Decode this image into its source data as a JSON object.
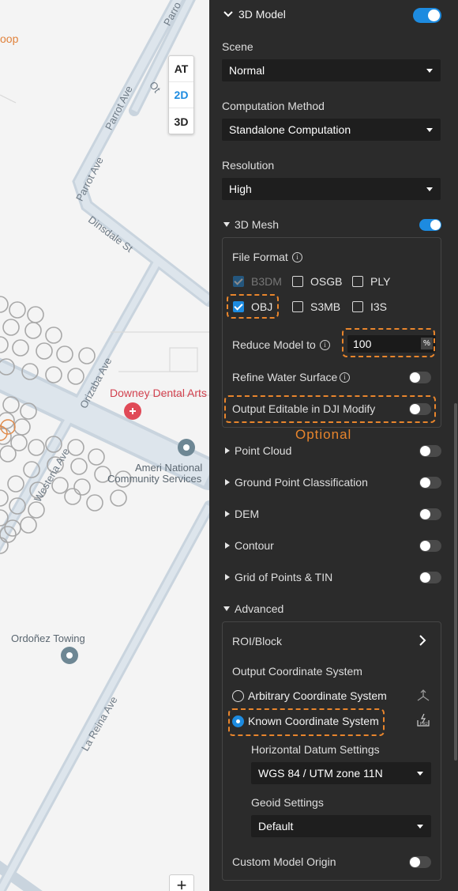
{
  "map": {
    "view_modes": [
      "AT",
      "2D",
      "3D"
    ],
    "active_view": "2D",
    "zoom_in": "+",
    "labels": {
      "loop": "oop",
      "parrot_ave_1": "Parrot Ave",
      "parrot_ave_2": "Parrot Ave",
      "parrot_ave_3": "Parrot Ave",
      "dinsdale": "Dinsdale St",
      "orizaba": "Orizaba Ave",
      "westeria": "Westeria Ave",
      "la_reina": "La Reina Ave",
      "top_street": "Parro",
      "ot_street": "Ot",
      "downey_dental": "Downey Dental Arts",
      "ameri_national": "Ameri National",
      "community_services": "Community Services",
      "ordonez": "Ordoñez Towing"
    }
  },
  "panel": {
    "section_title": "3D Model",
    "section_enabled": true,
    "scene_label": "Scene",
    "scene_value": "Normal",
    "computation_label": "Computation Method",
    "computation_value": "Standalone Computation",
    "resolution_label": "Resolution",
    "resolution_value": "High",
    "mesh": {
      "title": "3D Mesh",
      "enabled": true,
      "file_format_label": "File Format",
      "formats": [
        {
          "name": "B3DM",
          "checked": true,
          "disabled": true
        },
        {
          "name": "OSGB",
          "checked": false,
          "disabled": false
        },
        {
          "name": "PLY",
          "checked": false,
          "disabled": false
        },
        {
          "name": "OBJ",
          "checked": true,
          "disabled": false
        },
        {
          "name": "S3MB",
          "checked": false,
          "disabled": false
        },
        {
          "name": "I3S",
          "checked": false,
          "disabled": false
        }
      ],
      "reduce_label": "Reduce Model to",
      "reduce_value": "100",
      "reduce_unit": "%",
      "refine_water_label": "Refine Water Surface",
      "refine_water_enabled": false,
      "output_editable_label": "Output Editable in DJI Modify",
      "output_editable_enabled": false,
      "optional_note": "Optional"
    },
    "sections": [
      {
        "label": "Point Cloud",
        "enabled": false
      },
      {
        "label": "Ground Point Classification",
        "enabled": false
      },
      {
        "label": "DEM",
        "enabled": false
      },
      {
        "label": "Contour",
        "enabled": false
      },
      {
        "label": "Grid of Points & TIN",
        "enabled": false
      }
    ],
    "advanced": {
      "title": "Advanced",
      "roi_label": "ROI/Block",
      "output_cs_label": "Output Coordinate System",
      "arbitrary_label": "Arbitrary Coordinate System",
      "known_label": "Known Coordinate System",
      "selected": "known",
      "horizontal_label": "Horizontal Datum Settings",
      "horizontal_value": "WGS 84 / UTM zone 11N",
      "geoid_label": "Geoid Settings",
      "geoid_value": "Default",
      "custom_origin_label": "Custom Model Origin",
      "custom_origin_enabled": false
    }
  },
  "colors": {
    "accent": "#1d8be0",
    "highlight": "#e8852c",
    "panel_bg": "#2b2b2b",
    "map_bg": "#f4f4f4"
  }
}
